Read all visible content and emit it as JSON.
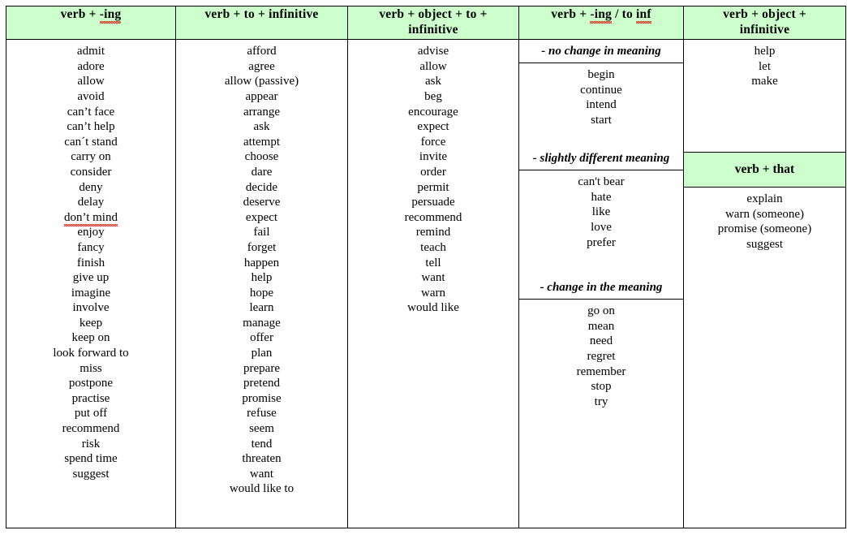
{
  "page": {
    "title": "Verb patterns reference table",
    "accent_header_color": "#ccffcc",
    "border_color": "#000000",
    "spellcheck_underline_color": "#d83a2a"
  },
  "columns": [
    {
      "id": "verb-ing",
      "header": {
        "pre": "verb  +  ",
        "main": "-ing",
        "post": "",
        "spellcheck_on": "-ing"
      },
      "words": [
        "admit",
        "adore",
        "allow",
        "avoid",
        "can’t face",
        "can’t help",
        "can´t stand",
        "carry on",
        "consider",
        "deny",
        "delay",
        "don’t mind",
        "enjoy",
        "fancy",
        "finish",
        "give up",
        "imagine",
        "involve",
        "keep",
        "keep on",
        "look forward to",
        "miss",
        "postpone",
        "practise",
        "put off",
        "recommend",
        "risk",
        "spend time",
        "suggest"
      ],
      "spellcheck_words": [
        "don’t mind"
      ]
    },
    {
      "id": "verb-to-infinitive",
      "header": {
        "pre": "verb  +  to  +  infinitive",
        "main": "",
        "post": ""
      },
      "words": [
        "afford",
        "agree",
        "allow (passive)",
        "appear",
        "arrange",
        "ask",
        "attempt",
        "choose",
        "dare",
        "decide",
        "deserve",
        "expect",
        "fail",
        "forget",
        "happen",
        "help",
        "hope",
        "learn",
        "manage",
        "offer",
        "plan",
        "prepare",
        "pretend",
        "promise",
        "refuse",
        "seem",
        "tend",
        "threaten",
        "want",
        "would like to"
      ],
      "spellcheck_words": []
    },
    {
      "id": "verb-object-to-infinitive",
      "header": {
        "line1": "verb  +  object  + to  +",
        "line2": "infinitive"
      },
      "words": [
        "advise",
        "allow",
        "ask",
        "beg",
        "encourage",
        "expect",
        "force",
        "invite",
        "order",
        "permit",
        "persuade",
        "recommend",
        "remind",
        "teach",
        "tell",
        "want",
        "warn",
        "would like"
      ],
      "spellcheck_words": []
    },
    {
      "id": "verb-ing-or-to-inf",
      "header": {
        "pre": "verb  +  ",
        "main": "-ing",
        "mid": " / to ",
        "post": "inf"
      },
      "sections": [
        {
          "label": "- no change in meaning",
          "words": [
            "begin",
            "continue",
            "intend",
            "start"
          ]
        },
        {
          "label": "- slightly different meaning",
          "words": [
            "can't bear",
            "hate",
            "like",
            "love",
            "prefer"
          ]
        },
        {
          "label": "- change in the meaning",
          "words": [
            "go on",
            "mean",
            "need",
            "regret",
            "remember",
            "stop",
            "try"
          ]
        }
      ]
    },
    {
      "id": "verb-object-infinitive",
      "header": {
        "line1": "verb  +  object  +",
        "line2": "infinitive"
      },
      "words": [
        "help",
        "let",
        "make"
      ],
      "second_header": {
        "text": "verb  +  that"
      },
      "second_words": [
        "explain",
        "warn (someone)",
        "promise (someone)",
        "suggest"
      ]
    }
  ]
}
